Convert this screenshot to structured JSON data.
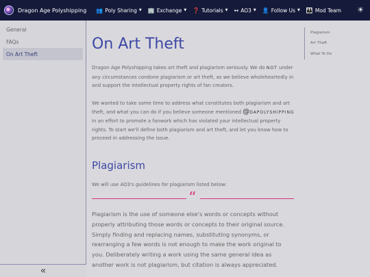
{
  "brand": {
    "title": "Dragon Age Polyshipping"
  },
  "nav": [
    {
      "label": "Poly Sharing",
      "icon": "users-icon",
      "glyph": "👥"
    },
    {
      "label": "Exchange",
      "icon": "building-icon",
      "glyph": "🏢"
    },
    {
      "label": "Tutorials",
      "icon": "question-icon",
      "glyph": "❓"
    },
    {
      "label": "AO3",
      "icon": "arrows-icon",
      "glyph": "↔"
    },
    {
      "label": "Follow Us",
      "icon": "user-plus-icon",
      "glyph": "👤"
    },
    {
      "label": "Mod Team",
      "icon": "team-icon",
      "glyph": "👪"
    }
  ],
  "theme_icon": "☀",
  "sidebar": {
    "items": [
      {
        "label": "General"
      },
      {
        "label": "FAQs"
      },
      {
        "label": "On Art Theft",
        "active": true
      }
    ],
    "collapse_glyph": "«"
  },
  "main": {
    "title": "On Art Theft",
    "p1_a": "Dragon Age Polyshipping takes art theft and plagiarism seriously. We do ",
    "p1_caps": "NOT",
    "p1_b": " under any circumstances condone plagiarism or art theft, as we believe wholeheartedly in and support the intellectual property rights of fan creators.",
    "p2_a": "We wanted to take some time to address what constitutes both plagiarism and art theft, and what you can do if you believe someone mentioned ",
    "p2_at": "@",
    "p2_mention": "DAPOLYSHIPPING",
    "p2_b": " in an effort to promote a fanwork which has violated your intellectual property rights. To start we'll define both plagiarism and art theft, and let you know how to proceed in addressing the issue.",
    "h2": "Plagiarism",
    "p3": "We will use AO3's guidelines for plagiarism listed below:",
    "quote_glyph": "“",
    "quote": "Plagiarism is the use of someone else's words or concepts without properly attributing those words or concepts to their original source. Simply finding and replacing names, substituting synonyms, or rearranging a few words is not enough to make the work original to you. Deliberately writing a work using the same general idea as another work is not plagiarism, but citation is always appreciated."
  },
  "toc": [
    {
      "label": "Plagiarism"
    },
    {
      "label": "Art Theft"
    },
    {
      "label": "What To Do"
    }
  ]
}
